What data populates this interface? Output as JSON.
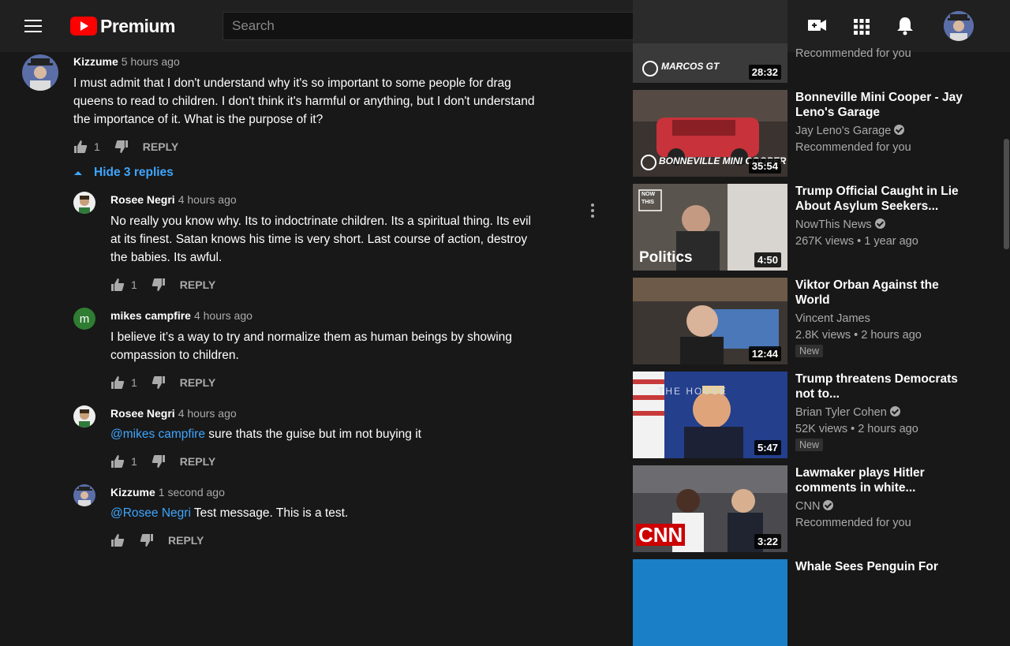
{
  "header": {
    "logo_text": "Premium",
    "search_placeholder": "Search"
  },
  "comments": [
    {
      "author": "Kizzume",
      "time": "5 hours ago",
      "lines": [
        "I must admit that I don't understand why it's so important to some people for drag",
        "queens to read to children.  I don't think it's harmful or anything, but I don't understand",
        "the importance of it.  What is the purpose of it?"
      ],
      "likes": "1",
      "reply_label": "REPLY"
    },
    {
      "author": "Rosee Negri",
      "time": "4 hours ago",
      "lines": [
        "No really you know why.  Its to indoctrinate children.  Its a spiritual thing.  Its evil",
        "at its finest. Satan knows his time is very short.  Last course of action, destroy",
        "the babies.  Its awful."
      ],
      "likes": "1",
      "reply_label": "REPLY"
    },
    {
      "author": "mikes campfire",
      "avatar_letter": "m",
      "time": "4 hours ago",
      "lines": [
        "I believe it’s a way to try and normalize them as human beings by showing",
        "compassion to children."
      ],
      "likes": "1",
      "reply_label": "REPLY"
    },
    {
      "author": "Rosee Negri",
      "time": "4 hours ago",
      "mention": "@mikes campfire",
      "text": " sure thats the guise but im not buying it",
      "likes": "1",
      "reply_label": "REPLY"
    },
    {
      "author": "Kizzume",
      "time": "1 second ago",
      "mention": "@Rosee Negri",
      "text": " Test message.  This is a test.",
      "reply_label": "REPLY"
    }
  ],
  "hide_replies_label": "Hide 3 replies",
  "sidebar": [
    {
      "title": "",
      "channel": "",
      "meta": "Recommended for you",
      "duration": "28:32",
      "thumb_text": "MARCOS GT"
    },
    {
      "title": "Bonneville Mini Cooper - Jay Leno's Garage",
      "channel": "Jay Leno's Garage",
      "meta": "Recommended for you",
      "duration": "35:54",
      "thumb_text": "BONNEVILLE MINI COOPER"
    },
    {
      "title": "Trump Official Caught in Lie About Asylum Seekers...",
      "channel": "NowThis News",
      "meta": "267K views • 1 year ago",
      "duration": "4:50",
      "thumb_text": "Politics",
      "thumb_badge": "NOW THIS"
    },
    {
      "title": "Viktor Orban Against the World",
      "channel": "Vincent James",
      "meta": "2.8K views • 2 hours ago",
      "badge": "New",
      "duration": "12:44"
    },
    {
      "title": "Trump threatens Democrats not to...",
      "channel": "Brian Tyler Cohen",
      "meta": "52K views • 2 hours ago",
      "badge": "New",
      "duration": "5:47",
      "thumb_text": "THE HOUSE"
    },
    {
      "title": "Lawmaker plays Hitler comments in white...",
      "channel": "CNN",
      "meta": "Recommended for you",
      "duration": "3:22",
      "thumb_text": "CNN"
    },
    {
      "title": "Whale Sees Penguin For",
      "channel": "",
      "meta": "",
      "duration": ""
    }
  ]
}
